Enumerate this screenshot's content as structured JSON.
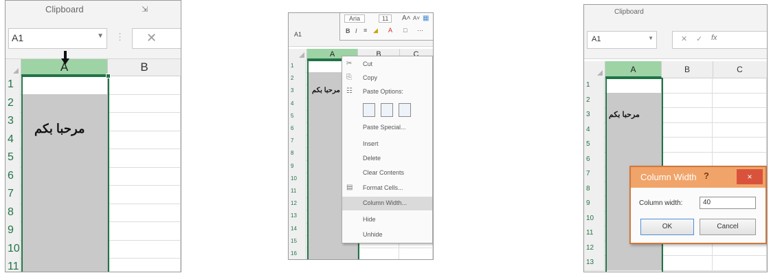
{
  "panel1": {
    "ribbon_group_label": "Clipboard",
    "launcher_icon": "dialog-launcher-icon",
    "name_box": "A1",
    "dropdown_icon": "chevron-down-icon",
    "more_icon": "vertical-dots-icon",
    "cancel_icon": "close-icon",
    "columns": [
      "A",
      "B"
    ],
    "rows": [
      "1",
      "2",
      "3",
      "4",
      "5",
      "6",
      "7",
      "8",
      "9",
      "10",
      "11"
    ],
    "cell_text": "مرحبا بكم",
    "arrow_icon": "down-arrow-icon"
  },
  "panel2": {
    "name_box": "A1",
    "font_name": "Aria",
    "font_size": "11",
    "columns": [
      "A",
      "B",
      "C"
    ],
    "rows": [
      "1",
      "2",
      "3",
      "4",
      "5",
      "6",
      "7",
      "8",
      "9",
      "10",
      "11",
      "12",
      "13",
      "14",
      "15",
      "16"
    ],
    "cell_text": "مرحبا بكم",
    "menu": [
      {
        "label": "Cut",
        "icon": "scissors-icon"
      },
      {
        "label": "Copy",
        "icon": "copy-icon"
      },
      {
        "label": "Paste Options:",
        "icon": "paste-icon"
      },
      {
        "label": "",
        "icon": ""
      },
      {
        "label": "Paste Special...",
        "icon": ""
      },
      {
        "label": "Insert",
        "icon": ""
      },
      {
        "label": "Delete",
        "icon": ""
      },
      {
        "label": "Clear Contents",
        "icon": ""
      },
      {
        "label": "Format Cells...",
        "icon": "format-cells-icon"
      },
      {
        "label": "Column Width...",
        "icon": ""
      },
      {
        "label": "Hide",
        "icon": ""
      },
      {
        "label": "Unhide",
        "icon": ""
      }
    ],
    "highlighted_item": "Column Width..."
  },
  "panel3": {
    "ribbon_group_label": "Clipboard",
    "name_box": "A1",
    "fx_label": "fx",
    "columns": [
      "A",
      "B",
      "C"
    ],
    "rows": [
      "1",
      "2",
      "3",
      "4",
      "5",
      "6",
      "7",
      "8",
      "9",
      "10",
      "11",
      "12",
      "13"
    ],
    "cell_text": "مرحبا بكم",
    "dialog": {
      "title": "Column Width",
      "help": "?",
      "close": "×",
      "field_label": "Column width:",
      "field_value": "40",
      "ok_label": "OK",
      "cancel_label": "Cancel"
    }
  },
  "colors": {
    "selected_header": "#9ed3a5",
    "selection_border": "#217346",
    "selected_fill": "#c9c9c9",
    "dialog_title": "#f0a46a",
    "dialog_close": "#d9533c"
  }
}
